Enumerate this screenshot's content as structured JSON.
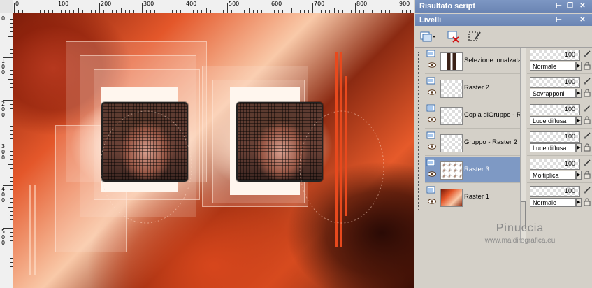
{
  "ruler": {
    "h_labels": [
      "0",
      "100",
      "200",
      "300",
      "400",
      "500",
      "600",
      "700",
      "800",
      "900"
    ],
    "v_labels": [
      "0",
      "100",
      "200",
      "300",
      "400",
      "500"
    ]
  },
  "panels": {
    "script_output_title": "Risultato script",
    "layers_title": "Livelli"
  },
  "layers": [
    {
      "name": "Selezione innalzata",
      "opacity": "100",
      "blend": "Normale",
      "selected": false
    },
    {
      "name": "Raster 2",
      "opacity": "100",
      "blend": "Sovrapponi",
      "selected": false
    },
    {
      "name": "Copia diGruppo - R",
      "opacity": "100",
      "blend": "Luce diffusa",
      "selected": false
    },
    {
      "name": "Gruppo - Raster 2",
      "opacity": "100",
      "blend": "Luce diffusa",
      "selected": false
    },
    {
      "name": "Raster 3",
      "opacity": "100",
      "blend": "Moltiplica",
      "selected": true
    },
    {
      "name": "Raster 1",
      "opacity": "100",
      "blend": "Normale",
      "selected": false
    }
  ],
  "watermark": {
    "name": "Pinuccia",
    "url": "www.maidiregrafica.eu"
  },
  "colors": {
    "title_bar": "#6a84b3",
    "selected_row": "#7e99c4",
    "panel_bg": "#d4d0c8"
  },
  "icons": {
    "new_layer": "new-layer-icon",
    "delete_layer": "delete-layer-icon",
    "edit_selection": "edit-selection-icon",
    "visibility": "eye-icon",
    "blend_paint": "brush-icon",
    "lock": "lock-icon"
  }
}
